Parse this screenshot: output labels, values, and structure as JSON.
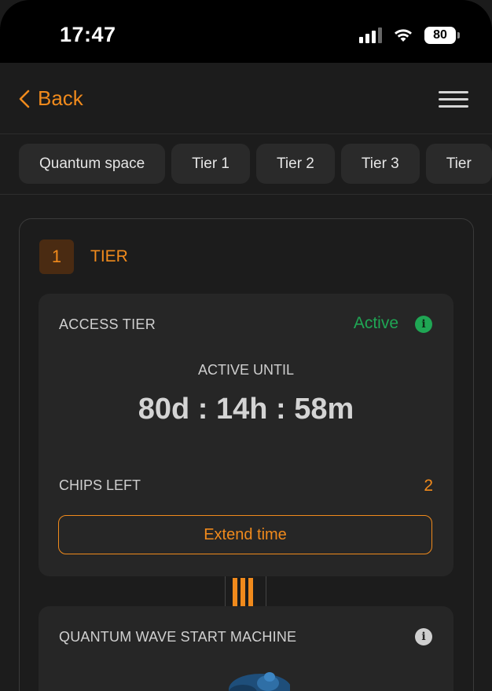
{
  "status_bar": {
    "time": "17:47",
    "battery": "80",
    "icons": [
      "signal-icon",
      "wifi-icon",
      "battery-icon"
    ]
  },
  "nav": {
    "back_label": "Back",
    "menu_icon": "hamburger-menu-icon"
  },
  "tabs": [
    {
      "label": "Quantum space"
    },
    {
      "label": "Tier 1"
    },
    {
      "label": "Tier 2"
    },
    {
      "label": "Tier 3"
    },
    {
      "label": "Tier"
    }
  ],
  "tier": {
    "number": "1",
    "label": "TIER"
  },
  "access": {
    "title": "ACCESS TIER",
    "status": "Active",
    "active_until_label": "ACTIVE UNTIL",
    "countdown": "80d : 14h : 58m",
    "chips_left_label": "CHIPS LEFT",
    "chips_left_value": "2",
    "extend_button": "Extend time"
  },
  "machine": {
    "title": "QUANTUM WAVE START MACHINE"
  },
  "colors": {
    "accent": "#f08a1c",
    "active": "#1fa654",
    "background": "#1c1c1c",
    "card": "#262626"
  }
}
